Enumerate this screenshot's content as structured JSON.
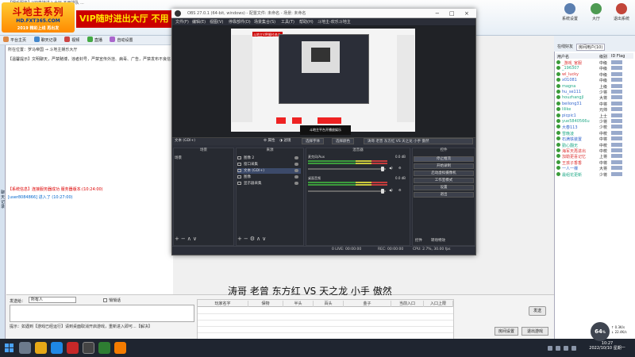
{
  "app": {
    "title_bar": "【娱乐服务】VIP直接进入大厅 不用排队 ...",
    "logo_line1": "斗地主系列",
    "logo_line2": "HD.FXT365.COM",
    "logo_line3": "2019 精彩上线 再出发",
    "vip_banner": "VIP随时进出大厅 不用",
    "top_icons": [
      "系统设置",
      "大厅",
      "退出系统"
    ],
    "nav": [
      "平台主页",
      "聊天记录",
      "视频",
      "直播",
      "自动设置"
    ],
    "location_label": "所在位置：罗马帝国 → 斗地主娱乐大厅",
    "notice": "【温馨提示】文明聊天，严禁赌博，违者封号，严禁宣传外挂、病毒、广告，严禁发布不良信息，严禁骚扰...",
    "chat_log_line1": "【系统信息】连接服务器成功 服务器版本:(10:24:00)",
    "chat_log_line2": "[user8084866] 进入了 (10:27:00)",
    "left_rail": "聊天记录",
    "speak_label": "发送给：",
    "speak_target": "所有人",
    "private_label": "悄悄话",
    "send_label": "发送",
    "tip": "提示：如遇到【游戏已经运行】请到桌面取消开启游戏，重新进入即可...【解决】",
    "room_settings": "房间设置",
    "exit_room": "退出游戏"
  },
  "right_panel": {
    "tabs": [
      "在线好友",
      "房间用户(10)"
    ],
    "headers": [
      "用户名",
      "级别",
      "ID Flag"
    ],
    "users": [
      {
        "name": "_游戏_官服",
        "level": "中级"
      },
      {
        "name": "_196307",
        "level": "中级"
      },
      {
        "name": "wl_lucky",
        "level": "中级"
      },
      {
        "name": "x01081",
        "level": "中级"
      },
      {
        "name": "magna",
        "level": "上级"
      },
      {
        "name": "hu_se111",
        "level": "少将"
      },
      {
        "name": "houzhangjl",
        "level": "大将"
      },
      {
        "name": "beilong31",
        "level": "中将"
      },
      {
        "name": "lilike",
        "level": "元帅"
      },
      {
        "name": "picpic1",
        "level": "上士"
      },
      {
        "name": "yue5840566u",
        "level": "少将"
      },
      {
        "name": "大春113",
        "level": "少校"
      },
      {
        "name": "雪晚凌",
        "level": "中校"
      },
      {
        "name": "石满铁装置",
        "level": "中将"
      },
      {
        "name": "勤心翻无",
        "level": "中校"
      },
      {
        "name": "海军天再进出",
        "level": "中校"
      },
      {
        "name": "加勒更喜记忆",
        "level": "上将"
      },
      {
        "name": "王孩子香香",
        "level": "中将"
      },
      {
        "name": "一人一棵",
        "level": "大将"
      },
      {
        "name": "最组花更新",
        "level": "少将"
      }
    ]
  },
  "obs": {
    "title": "OBS 27.0.1 (64-bit, windows) - 配置文件: 未命名 - 场景: 未命名",
    "menu": [
      "文件(F)",
      "编辑(E)",
      "视图(V)",
      "停靠部件(D)",
      "场景集合(S)",
      "工具(T)",
      "帮助(H)",
      "斗地主-欢乐斗地主"
    ],
    "preview_caption": "斗地主VIP随时进出",
    "preview_text": "斗地主平台开播放娱乐",
    "textbar": {
      "source_label": "文本 (GDI+)",
      "properties": "属性",
      "filters": "滤镜",
      "select_font": "选择字体",
      "select_color": "选择颜色",
      "text_value": "涛哥 老曾 东方红 VS 天之龙 小手 傲然"
    },
    "docks": {
      "scenes_title": "场景",
      "sources_title": "来源",
      "mixer_title": "混音器",
      "controls_title": "控件"
    },
    "scenes": [
      "场景"
    ],
    "sources": [
      "图像 2",
      "窗口采集",
      "文本 (GDI+)",
      "图像",
      "显示器采集"
    ],
    "mixer": [
      {
        "name": "麦克风/Aux",
        "db": "0.0 dB"
      },
      {
        "name": "桌面音频",
        "db": "0.0 dB"
      }
    ],
    "controls": [
      "停止推流",
      "开始录制",
      "启动虚拟摄像机",
      "工作室模式",
      "设置",
      "退出"
    ],
    "dock_tabs": [
      "控件",
      "转场特效"
    ],
    "status": {
      "dropped": "0 LIVE: 00:00:00",
      "rec": "REC: 00:00:00",
      "cpu": "CPU: 2.7%, 30.00 fps"
    }
  },
  "caption": "涛哥 老曾 东方红 VS 天之龙 小手 傲然",
  "sheet": {
    "headers": [
      "玩家名字",
      "保物",
      "半头",
      "百头",
      "金子",
      "当前入口",
      "入口上限"
    ]
  },
  "tray": {
    "time": "10:27",
    "date": "2022/10/10 星期一",
    "net_value": "64",
    "net_unit": "%",
    "net_up": "↑ 0.3K/s",
    "net_down": "↓ 22.4K/s"
  }
}
